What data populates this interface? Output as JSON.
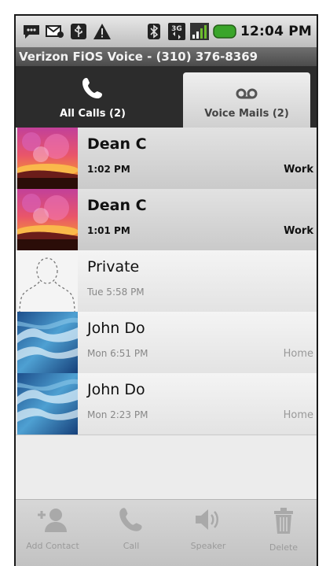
{
  "status_bar": {
    "time": "12:04 PM",
    "icons": [
      "message-icon",
      "mail-icon",
      "usb-icon",
      "warning-icon",
      "bluetooth-icon",
      "3g-icon",
      "signal-icon",
      "battery-icon"
    ]
  },
  "title": "Verizon FiOS Voice - (310) 376-8369",
  "tabs": [
    {
      "label": "All Calls (2)",
      "icon": "phone-icon",
      "selected": true
    },
    {
      "label": "Voice Mails (2)",
      "icon": "voicemail-icon",
      "selected": false
    }
  ],
  "calls": [
    {
      "name": "Dean C",
      "time": "1:02 PM",
      "label": "Work",
      "unread": true,
      "photo": "sunset"
    },
    {
      "name": "Dean C",
      "time": "1:01 PM",
      "label": "Work",
      "unread": true,
      "photo": "sunset"
    },
    {
      "name": "Private",
      "time": "Tue 5:58 PM",
      "label": "",
      "unread": false,
      "photo": "placeholder"
    },
    {
      "name": "John Do",
      "time": "Mon 6:51 PM",
      "label": "Home",
      "unread": false,
      "photo": "wave"
    },
    {
      "name": "John Do",
      "time": "Mon 2:23 PM",
      "label": "Home",
      "unread": false,
      "photo": "wave"
    }
  ],
  "actions": [
    {
      "label": "Add Contact",
      "icon": "add-contact-icon"
    },
    {
      "label": "Call",
      "icon": "phone-icon"
    },
    {
      "label": "Speaker",
      "icon": "speaker-icon"
    },
    {
      "label": "Delete",
      "icon": "trash-icon"
    }
  ]
}
